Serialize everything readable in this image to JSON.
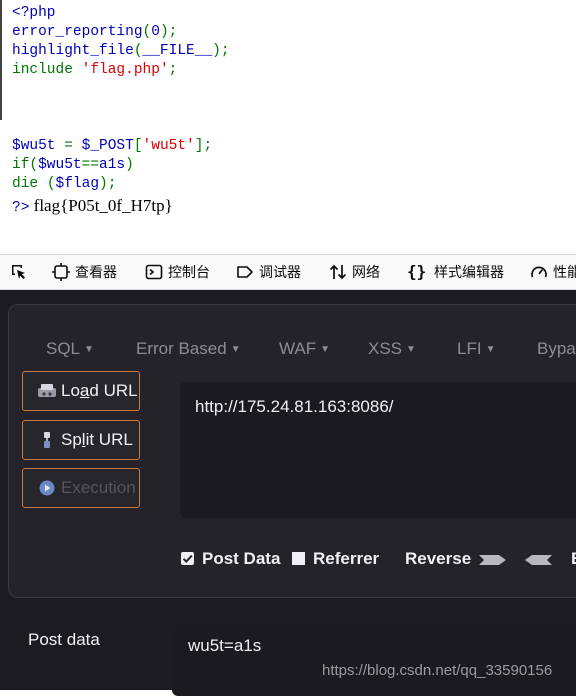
{
  "source": {
    "lines": [
      {
        "id": "l1",
        "parts": [
          {
            "t": "<?php",
            "c": "blue"
          }
        ]
      },
      {
        "id": "l2",
        "parts": [
          {
            "t": "error_reporting",
            "c": "blue"
          },
          {
            "t": "(",
            "c": "green"
          },
          {
            "t": "0",
            "c": "blue"
          },
          {
            "t": ");",
            "c": "green"
          }
        ]
      },
      {
        "id": "l3",
        "parts": [
          {
            "t": "highlight_file",
            "c": "blue"
          },
          {
            "t": "(",
            "c": "green"
          },
          {
            "t": "__FILE__",
            "c": "blue"
          },
          {
            "t": ");",
            "c": "green"
          }
        ]
      },
      {
        "id": "l4",
        "parts": [
          {
            "t": "include ",
            "c": "green"
          },
          {
            "t": "'flag.php'",
            "c": "red"
          },
          {
            "t": ";",
            "c": "green"
          }
        ]
      },
      {
        "id": "l5",
        "parts": [
          {
            "t": "$wu5t ",
            "c": "blue"
          },
          {
            "t": "= ",
            "c": "green"
          },
          {
            "t": "$_POST",
            "c": "blue"
          },
          {
            "t": "[",
            "c": "green"
          },
          {
            "t": "'wu5t'",
            "c": "red"
          },
          {
            "t": "];",
            "c": "green"
          }
        ]
      },
      {
        "id": "l6",
        "parts": [
          {
            "t": "if(",
            "c": "green"
          },
          {
            "t": "$wu5t",
            "c": "blue"
          },
          {
            "t": "==",
            "c": "green"
          },
          {
            "t": "a1s",
            "c": "blue"
          },
          {
            "t": ")",
            "c": "green"
          }
        ]
      },
      {
        "id": "l7",
        "parts": [
          {
            "t": "die ",
            "c": "green"
          },
          {
            "t": "(",
            "c": "green"
          },
          {
            "t": "$flag",
            "c": "blue"
          },
          {
            "t": ");",
            "c": "green"
          }
        ]
      }
    ],
    "close_tag": "?>",
    "flag_output": "flag{P05t_0f_H7tp}"
  },
  "devtools": {
    "tabs": [
      {
        "label": "查看器",
        "icon": "inspector-icon"
      },
      {
        "label": "控制台",
        "icon": "console-icon"
      },
      {
        "label": "调试器",
        "icon": "debugger-icon"
      },
      {
        "label": "网络",
        "icon": "network-icon"
      },
      {
        "label": "样式编辑器",
        "icon": "style-editor-icon"
      },
      {
        "label": "性能",
        "icon": "performance-icon"
      }
    ]
  },
  "hackbar": {
    "menu": [
      {
        "label": "SQL"
      },
      {
        "label": "Error Based"
      },
      {
        "label": "WAF"
      },
      {
        "label": "XSS"
      },
      {
        "label": "LFI"
      },
      {
        "label": "Bypass"
      }
    ],
    "buttons": {
      "load_pre": "Lo",
      "load_u": "a",
      "load_post": "d URL",
      "split_pre": "Sp",
      "split_u": "l",
      "split_post": "it URL",
      "execute": "Execution"
    },
    "url": "http://175.24.81.163:8086/",
    "options": {
      "post_data": "Post Data",
      "referrer": "Referrer",
      "reverse": "Reverse",
      "post_checked": true,
      "referrer_checked": false
    },
    "post_label": "Post data",
    "post_value": "wu5t=a1s"
  },
  "watermark": "https://blog.csdn.net/qq_33590156",
  "colors": {
    "php_default": "#0000bb",
    "php_keyword": "#007700",
    "php_string": "#dd0000",
    "hackbar_bg": "#1c1b22",
    "button_border": "#c97a3a"
  }
}
